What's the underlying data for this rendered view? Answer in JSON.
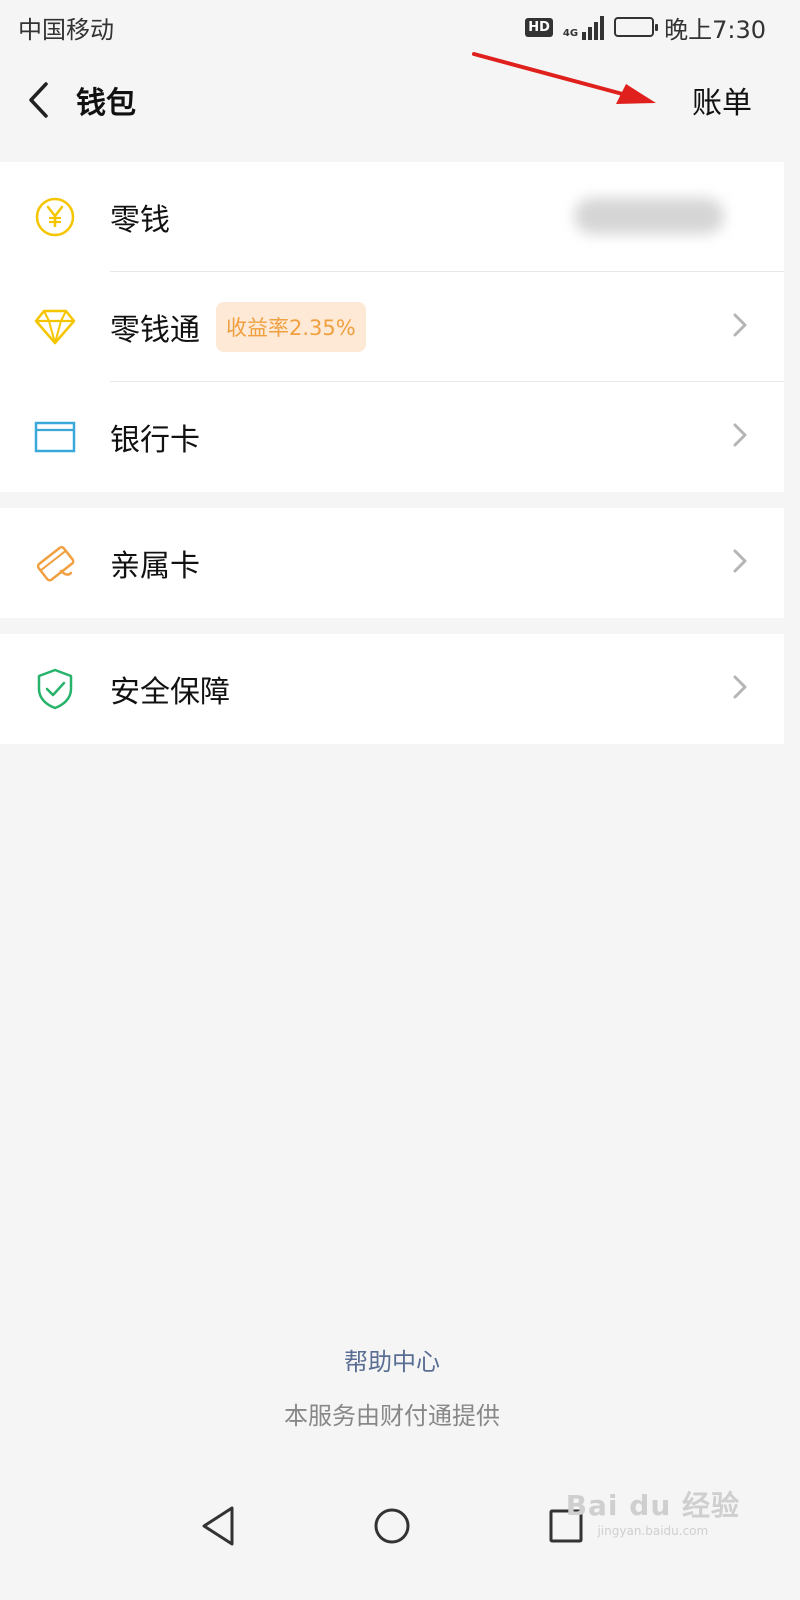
{
  "status_bar": {
    "carrier": "中国移动",
    "hd": "HD",
    "network": "4G",
    "time": "晚上7:30"
  },
  "header": {
    "title": "钱包",
    "bill_label": "账单"
  },
  "wallet": {
    "items": [
      {
        "label": "零钱",
        "icon": "yuan-coin-icon",
        "icon_color": "#f5c500",
        "value_hidden": true
      },
      {
        "label": "零钱通",
        "icon": "diamond-icon",
        "icon_color": "#f5c500",
        "badge": "收益率2.35%"
      },
      {
        "label": "银行卡",
        "icon": "bank-card-icon",
        "icon_color": "#3aa9d9"
      }
    ],
    "family_card": {
      "label": "亲属卡",
      "icon": "family-card-icon",
      "icon_color": "#f0a040"
    },
    "security": {
      "label": "安全保障",
      "icon": "shield-check-icon",
      "icon_color": "#27b36a"
    }
  },
  "footer": {
    "help_link": "帮助中心",
    "provider_note": "本服务由财付通提供"
  },
  "watermark": {
    "text": "Bai du 经验",
    "sub": "jingyan.baidu.com"
  },
  "colors": {
    "background": "#f5f5f5",
    "link": "#5a6e94",
    "badge_bg": "#fde9d5",
    "badge_text": "#f0a040",
    "annotation_arrow": "#e0201c"
  }
}
